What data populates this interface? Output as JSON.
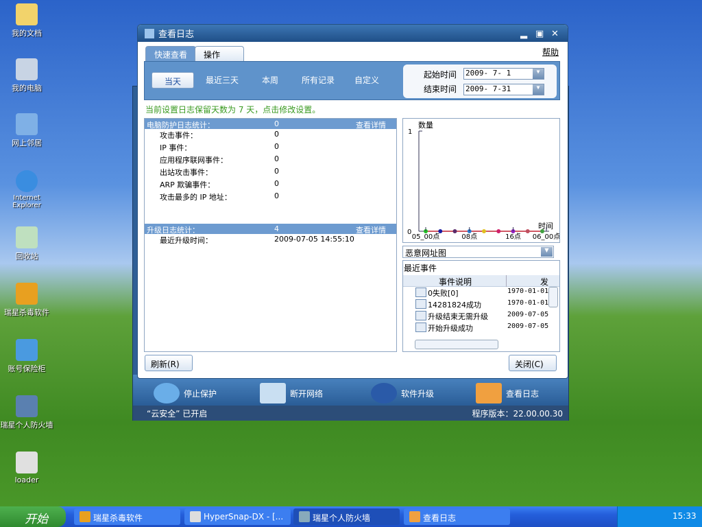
{
  "desktop": {
    "icons": [
      "我的文档",
      "我的电脑",
      "网上邻居",
      "Internet Explorer",
      "回收站",
      "瑞星杀毒软件",
      "账号保险柜",
      "瑞星个人防火墙",
      "loader"
    ]
  },
  "app": {
    "buttons": [
      "停止保护",
      "断开网络",
      "软件升级",
      "查看日志"
    ],
    "cloud_status": "“云安全” 已开启",
    "version": "程序版本：22.00.00.30"
  },
  "dialog": {
    "title": "查看日志",
    "tabs": [
      "快速查看",
      "操作"
    ],
    "help": "帮助",
    "quick_buttons": [
      "当天",
      "最近三天",
      "本周",
      "所有记录",
      "自定义"
    ],
    "start_label": "起始时间",
    "start_value": "2009- 7- 1",
    "end_label": "结束时间",
    "end_value": "2009- 7-31",
    "notice": "当前设置日志保留天数为 7 天，点击修改设置。",
    "pc_stats": {
      "title": "电脑防护日志统计：",
      "total": "0",
      "detail": "查看详情",
      "rows": [
        {
          "label": "攻击事件：",
          "value": "0"
        },
        {
          "label": "IP 事件：",
          "value": "0"
        },
        {
          "label": "应用程序联网事件：",
          "value": "0"
        },
        {
          "label": "出站攻击事件：",
          "value": "0"
        },
        {
          "label": "ARP 欺骗事件：",
          "value": "0"
        },
        {
          "label": "攻击最多的 IP 地址：",
          "value": "0"
        }
      ]
    },
    "upgrade_stats": {
      "title": "升级日志统计：",
      "total": "4",
      "detail": "查看详情",
      "rows": [
        {
          "label": "最近升级时间：",
          "value": "2009-07-05 14:55:10"
        }
      ]
    },
    "chart_select": "恶意网址图",
    "recent": {
      "title": "最近事件",
      "col1": "事件说明",
      "col2": "发",
      "rows": [
        {
          "desc": "0失败[0]",
          "time": "1970-01-01"
        },
        {
          "desc": "14281824成功",
          "time": "1970-01-01"
        },
        {
          "desc": "升级结束无需升级",
          "time": "2009-07-05"
        },
        {
          "desc": "开始升级成功",
          "time": "2009-07-05"
        }
      ]
    },
    "refresh": "刷新(R)",
    "close": "关闭(C)"
  },
  "chart_data": {
    "type": "line",
    "ylabel": "数量",
    "xlabel": "时间",
    "ylim": [
      0,
      1
    ],
    "y_ticks": [
      "0",
      "1"
    ],
    "x_ticks": [
      "05_00点",
      "08点",
      "16点",
      "06_00点"
    ],
    "values": [
      0,
      0,
      0,
      0,
      0,
      0,
      0,
      0,
      0
    ],
    "point_colors": [
      "#22c022",
      "#1a1aa0",
      "#5a2a6a",
      "#2a7ad0",
      "#e0c020",
      "#d0206a",
      "#9020c0",
      "#c05060",
      "#40a040"
    ]
  },
  "taskbar": {
    "start": "开始",
    "items": [
      "瑞星杀毒软件",
      "HyperSnap-DX - [...",
      "瑞星个人防火墙",
      "查看日志"
    ],
    "clock": "15:33"
  }
}
